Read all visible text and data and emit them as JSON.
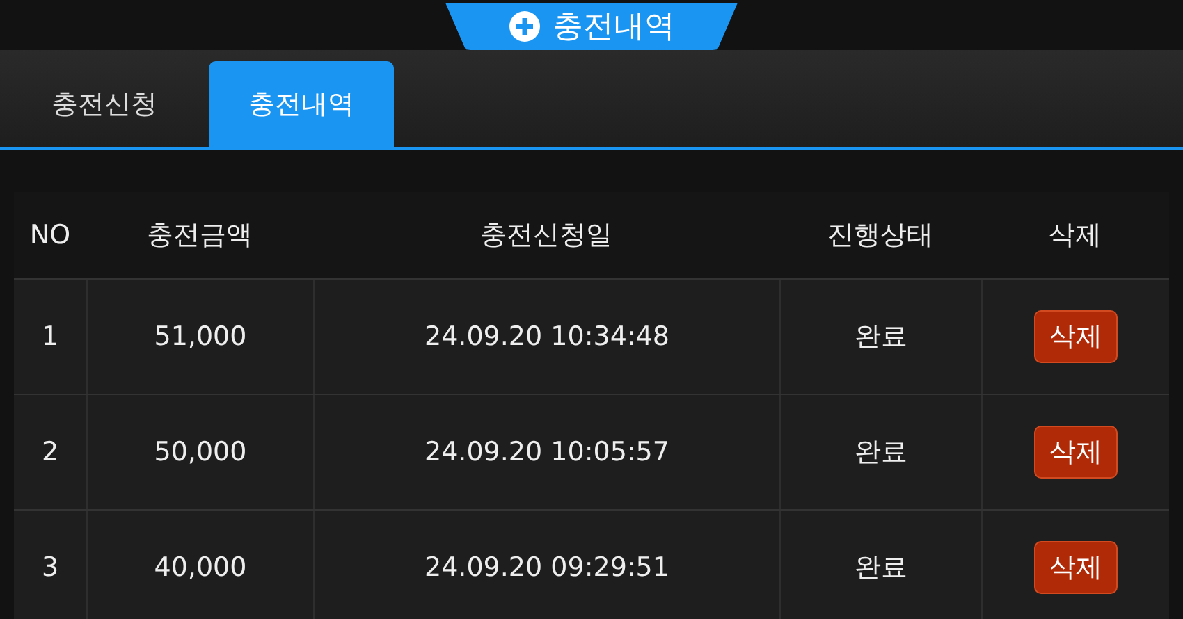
{
  "title": {
    "label": "충전내역"
  },
  "tabs": [
    {
      "label": "충전신청",
      "selected": false
    },
    {
      "label": "충전내역",
      "selected": true
    }
  ],
  "table": {
    "columns": [
      "NO",
      "충전금액",
      "충전신청일",
      "진행상태",
      "삭제"
    ],
    "rows": [
      {
        "no": "1",
        "amount": "51,000",
        "date": "24.09.20 10:34:48",
        "status": "완료",
        "action": "삭제"
      },
      {
        "no": "2",
        "amount": "50,000",
        "date": "24.09.20 10:05:57",
        "status": "완료",
        "action": "삭제"
      },
      {
        "no": "3",
        "amount": "40,000",
        "date": "24.09.20 09:29:51",
        "status": "완료",
        "action": "삭제"
      }
    ]
  }
}
